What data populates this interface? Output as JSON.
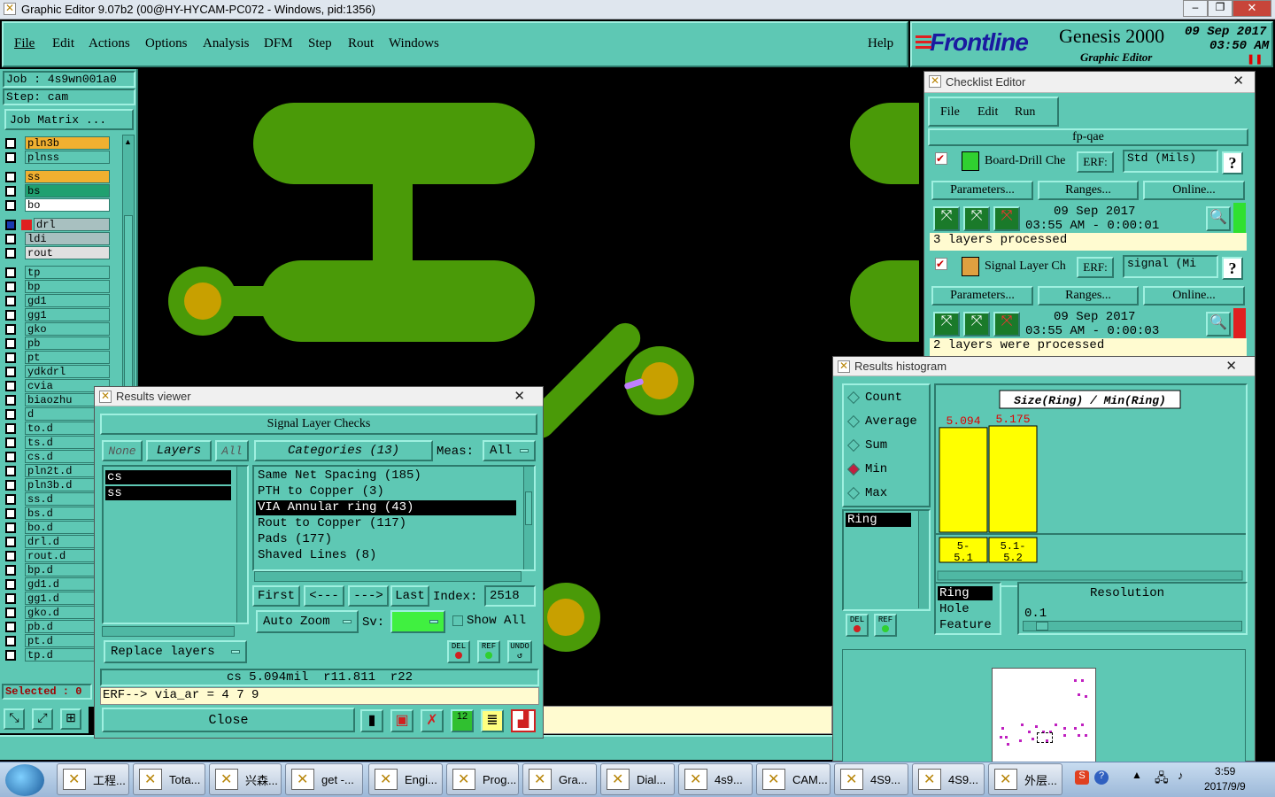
{
  "titlebar": {
    "title": "Graphic Editor 9.07b2 (00@HY-HYCAM-PC072 - Windows, pid:1356)"
  },
  "menu": {
    "items": [
      "File",
      "Edit",
      "Actions",
      "Options",
      "Analysis",
      "DFM",
      "Step",
      "Rout",
      "Windows"
    ],
    "help": "Help"
  },
  "brand": {
    "logo": "Frontline",
    "product": "Genesis 2000",
    "sub": "Graphic Editor",
    "date": "09 Sep 2017",
    "time": "03:50 AM",
    "pause": "❚❚"
  },
  "job": {
    "job": "Job : 4s9wn001a0",
    "step": "Step: cam",
    "matrix": "Job Matrix ..."
  },
  "layers": [
    "pln3b",
    "plnss",
    "ss",
    "bs",
    "bo",
    "drl",
    "ldi",
    "rout",
    "tp",
    "bp",
    "gd1",
    "gg1",
    "gko",
    "pb",
    "pt",
    "ydkdrl",
    "cvia",
    "biaozhu",
    "d",
    "to.d",
    "ts.d",
    "cs.d",
    "pln2t.d",
    "pln3b.d",
    "ss.d",
    "bs.d",
    "bo.d",
    "drl.d",
    "rout.d",
    "bp.d",
    "gd1.d",
    "gg1.d",
    "gko.d",
    "pb.d",
    "pt.d",
    "tp.d"
  ],
  "selected": "Selected : 0",
  "checklist": {
    "title": "Checklist Editor",
    "menu": [
      "File",
      "Edit",
      "Run"
    ],
    "name": "fp-qae",
    "items": [
      {
        "label": "Board-Drill Che",
        "erf": "ERF:",
        "erf_value": "Std (Mils)",
        "q": "?",
        "params": "Parameters...",
        "ranges": "Ranges...",
        "online": "Online...",
        "date": "09 Sep 2017",
        "time": "03:55 AM - 0:00:01",
        "status": "3 layers processed"
      },
      {
        "label": "Signal Layer Ch",
        "erf": "ERF:",
        "erf_value": "signal (Mi",
        "q": "?",
        "params": "Parameters...",
        "ranges": "Ranges...",
        "online": "Online...",
        "date": "09 Sep 2017",
        "time": "03:55 AM - 0:00:03",
        "status": "2 layers were processed"
      }
    ]
  },
  "results_viewer": {
    "title": "Results viewer",
    "heading": "Signal Layer Checks",
    "none": "None",
    "layers_label": "Layers",
    "all": "All",
    "categories_label": "Categories (13)",
    "meas_label": "Meas:",
    "meas_value": "All",
    "layer_list": [
      "cs",
      "ss"
    ],
    "categories": [
      "Same Net Spacing (185)",
      "PTH to Copper (3)",
      "VIA Annular ring (43)",
      "Rout to Copper (117)",
      "Pads (177)",
      "Shaved Lines (8)"
    ],
    "first": "First",
    "prev": "<---",
    "next": "--->",
    "last": "Last",
    "index_label": "Index:",
    "index_value": "2518",
    "auto_zoom": "Auto Zoom",
    "sv_label": "Sv:",
    "show_all": "Show All",
    "replace_layers": "Replace layers",
    "del": "DEL",
    "ref": "REF",
    "undo": "UNDO",
    "measure_line": "cs 5.094mil  r11.811  r22",
    "erf_line": "ERF--> via_ar = 4 7 9",
    "close": "Close"
  },
  "histogram": {
    "title": "Results histogram",
    "options": [
      "Count",
      "Average",
      "Sum",
      "Min",
      "Max"
    ],
    "selected_option": "Min",
    "list": [
      "Ring"
    ],
    "chart_title": "Size(Ring) / Min(Ring)",
    "del": "DEL",
    "ref": "REF",
    "types": [
      "Ring",
      "Hole",
      "Feature"
    ],
    "resolution_label": "Resolution",
    "resolution_value": "0.1"
  },
  "chart_data": {
    "type": "bar",
    "title": "Size(Ring) / Min(Ring)",
    "categories": [
      "5-5.1",
      "5.1-5.2"
    ],
    "category_lines": [
      [
        "5-",
        "5.1"
      ],
      [
        "5.1-",
        "5.2"
      ]
    ],
    "values": [
      5.094,
      5.175
    ],
    "value_labels": [
      "5.094",
      "5.175"
    ],
    "bar_color": "#ffff00"
  },
  "taskbar": {
    "items": [
      "工程...",
      "Tota...",
      "兴森...",
      "get -...",
      "Engi...",
      "Prog...",
      "Gra...",
      "Dial...",
      "4s9...",
      "CAM...",
      "4S9...",
      "4S9...",
      "外层..."
    ],
    "time": "3:59",
    "date": "2017/9/9"
  },
  "colors": {
    "panel": "#5ec8b4",
    "copper": "#4a9a08",
    "pad": "#c8a000",
    "highlight": "#ffff00"
  }
}
